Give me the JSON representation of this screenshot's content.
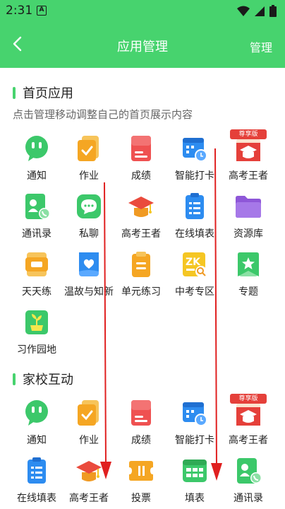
{
  "status": {
    "time": "2:31",
    "notif": "A"
  },
  "header": {
    "title": "应用管理",
    "manage": "管理"
  },
  "home_apps": {
    "title": "首页应用",
    "subtitle": "点击管理移动调整自己的首页展示内容",
    "items": [
      {
        "label": "通知",
        "icon": "chat-icon",
        "color": "#3cc86a"
      },
      {
        "label": "作业",
        "icon": "homework-icon",
        "color": "#f5a623"
      },
      {
        "label": "成绩",
        "icon": "score-icon",
        "color": "#ef5151"
      },
      {
        "label": "智能打卡",
        "icon": "calendar-clock-icon",
        "color": "#2d8cf0"
      },
      {
        "label": "高考王者",
        "icon": "gaokao-badge-icon",
        "color": "#e5403a",
        "badge": "尊享版"
      },
      {
        "label": "通讯录",
        "icon": "contacts-icon",
        "color": "#3cc86a"
      },
      {
        "label": "私聊",
        "icon": "private-chat-icon",
        "color": "#3cc86a"
      },
      {
        "label": "高考王者",
        "icon": "graduation-cap-icon",
        "color": "#f5a623"
      },
      {
        "label": "在线填表",
        "icon": "form-icon",
        "color": "#2d8cf0"
      },
      {
        "label": "资源库",
        "icon": "folder-icon",
        "color": "#9b59b6"
      },
      {
        "label": "天天练",
        "icon": "daily-practice-icon",
        "color": "#f5a623"
      },
      {
        "label": "温故与知新",
        "icon": "heart-book-icon",
        "color": "#2d8cf0"
      },
      {
        "label": "单元练习",
        "icon": "clipboard-icon",
        "color": "#f5a623"
      },
      {
        "label": "中考专区",
        "icon": "zk-icon",
        "color": "#f5c623"
      },
      {
        "label": "专题",
        "icon": "star-bookmark-icon",
        "color": "#3cc86a"
      },
      {
        "label": "习作园地",
        "icon": "plant-icon",
        "color": "#3cc86a"
      }
    ]
  },
  "home_school": {
    "title": "家校互动",
    "items": [
      {
        "label": "通知",
        "icon": "chat-icon",
        "color": "#3cc86a"
      },
      {
        "label": "作业",
        "icon": "homework-icon",
        "color": "#f5a623"
      },
      {
        "label": "成绩",
        "icon": "score-icon",
        "color": "#ef5151"
      },
      {
        "label": "智能打卡",
        "icon": "calendar-clock-icon",
        "color": "#2d8cf0"
      },
      {
        "label": "高考王者",
        "icon": "gaokao-badge-icon",
        "color": "#e5403a",
        "badge": "尊享版"
      },
      {
        "label": "在线填表",
        "icon": "form-icon",
        "color": "#2d8cf0"
      },
      {
        "label": "高考王者",
        "icon": "graduation-cap-icon",
        "color": "#f5a623"
      },
      {
        "label": "投票",
        "icon": "ticket-icon",
        "color": "#f5a623"
      },
      {
        "label": "填表",
        "icon": "grid-table-icon",
        "color": "#3cc86a"
      },
      {
        "label": "通讯录",
        "icon": "contacts-icon",
        "color": "#3cc86a"
      }
    ]
  }
}
